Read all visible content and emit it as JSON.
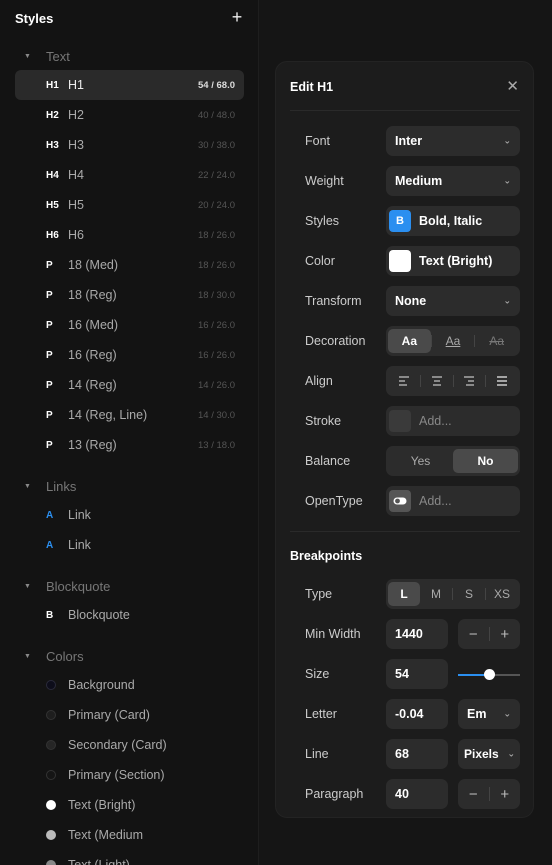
{
  "sidebar": {
    "title": "Styles",
    "add_icon": "plus-icon",
    "sections": {
      "text": "Text",
      "links": "Links",
      "blockquote": "Blockquote",
      "colors": "Colors"
    },
    "text_styles": [
      {
        "tag": "H1",
        "name": "H1",
        "meta": "54 / 68.0"
      },
      {
        "tag": "H2",
        "name": "H2",
        "meta": "40 / 48.0"
      },
      {
        "tag": "H3",
        "name": "H3",
        "meta": "30 / 38.0"
      },
      {
        "tag": "H4",
        "name": "H4",
        "meta": "22 / 24.0"
      },
      {
        "tag": "H5",
        "name": "H5",
        "meta": "20 / 24.0"
      },
      {
        "tag": "H6",
        "name": "H6",
        "meta": "18 / 26.0"
      },
      {
        "tag": "P",
        "name": "18 (Med)",
        "meta": "18 / 26.0"
      },
      {
        "tag": "P",
        "name": "18 (Reg)",
        "meta": "18 / 30.0"
      },
      {
        "tag": "P",
        "name": "16 (Med)",
        "meta": "16 / 26.0"
      },
      {
        "tag": "P",
        "name": "16 (Reg)",
        "meta": "16 / 26.0"
      },
      {
        "tag": "P",
        "name": "14 (Reg)",
        "meta": "14 / 26.0"
      },
      {
        "tag": "P",
        "name": "14 (Reg, Line)",
        "meta": "14 / 30.0"
      },
      {
        "tag": "P",
        "name": "13 (Reg)",
        "meta": "13 / 18.0"
      }
    ],
    "links": [
      {
        "tag": "A",
        "name": "Link"
      },
      {
        "tag": "A",
        "name": "Link"
      }
    ],
    "blockquotes": [
      {
        "tag": "B",
        "name": "Blockquote"
      }
    ],
    "colors": [
      {
        "name": "Background",
        "color": "#0d0d1a",
        "border": "#2a2a3a"
      },
      {
        "name": "Primary (Card)",
        "color": "#1e1e1e",
        "border": "#333333"
      },
      {
        "name": "Secondary (Card)",
        "color": "#262626",
        "border": "#333333"
      },
      {
        "name": "Primary (Section)",
        "color": "#151515",
        "border": "#333333"
      },
      {
        "name": "Text (Bright)",
        "color": "#ffffff",
        "border": "#ffffff"
      },
      {
        "name": "Text (Medium",
        "color": "#bbbbbb",
        "border": "#bbbbbb"
      },
      {
        "name": "Text (Light)",
        "color": "#888888",
        "border": "#888888"
      }
    ]
  },
  "panel": {
    "title": "Edit H1",
    "close_icon": "close-icon",
    "labels": {
      "font": "Font",
      "weight": "Weight",
      "styles": "Styles",
      "color": "Color",
      "transform": "Transform",
      "decoration": "Decoration",
      "align": "Align",
      "stroke": "Stroke",
      "balance": "Balance",
      "opentype": "OpenType"
    },
    "values": {
      "font": "Inter",
      "weight": "Medium",
      "styles": "Bold, Italic",
      "color": "Text (Bright)",
      "transform": "None",
      "stroke_placeholder": "Add...",
      "opentype_placeholder": "Add..."
    },
    "decoration_options": [
      "Aa",
      "Aa",
      "Aa"
    ],
    "balance_options": [
      "Yes",
      "No"
    ],
    "breakpoints": {
      "title": "Breakpoints",
      "labels": {
        "type": "Type",
        "min_width": "Min Width",
        "size": "Size",
        "letter": "Letter",
        "line": "Line",
        "paragraph": "Paragraph"
      },
      "type_options": [
        "L",
        "M",
        "S",
        "XS"
      ],
      "min_width": "1440",
      "size": "54",
      "size_slider_level": 0.5,
      "letter": "-0.04",
      "letter_unit": "Em",
      "line": "68",
      "line_unit": "Pixels",
      "paragraph": "40"
    }
  },
  "colors": {
    "accent": "#2b8ff0"
  }
}
